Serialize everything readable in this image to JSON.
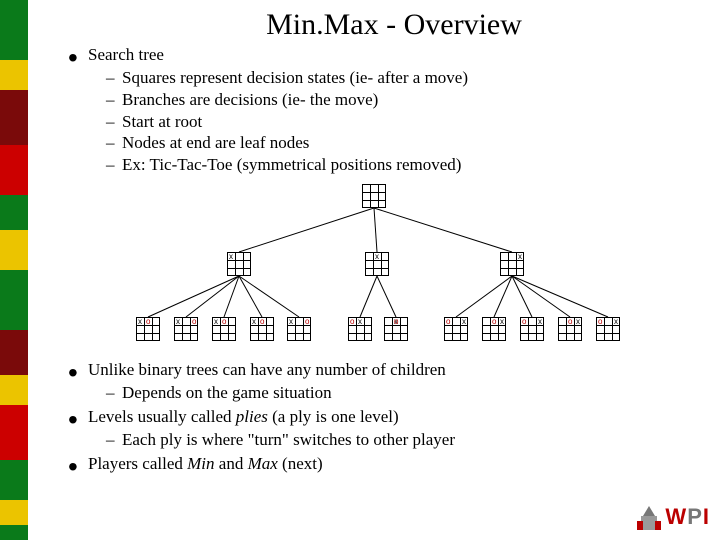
{
  "title": "Min.Max - Overview",
  "bullets": [
    {
      "text": "Search tree",
      "sub": [
        "Squares represent decision states (ie- after a move)",
        "Branches are decisions (ie- the move)",
        "Start at root",
        "Nodes at end are leaf nodes",
        "Ex: Tic-Tac-Toe (symmetrical positions removed)"
      ]
    },
    {
      "text": "Unlike binary trees can have any number of children",
      "sub": [
        "Depends on the game situation"
      ]
    },
    {
      "text": "Levels usually called plies (a ply is one level)",
      "sub": [
        "Each ply is where \"turn\" switches to other player"
      ]
    },
    {
      "text": "Players called Min and Max (next)",
      "sub": []
    }
  ],
  "sidebar_colors": [
    "#0a7a1a",
    "#ebc400",
    "#7a0a0a",
    "#cc0000",
    "#0a7a1a",
    "#ebc400",
    "#0a7a1a",
    "#7a0a0a",
    "#ebc400",
    "#cc0000",
    "#0a7a1a",
    "#ebc400",
    "#0a7a1a"
  ],
  "logo": {
    "w": "W",
    "p": "P",
    "i": "I",
    "wcol": "#b00",
    "pcol": "#777",
    "icol": "#b00"
  }
}
